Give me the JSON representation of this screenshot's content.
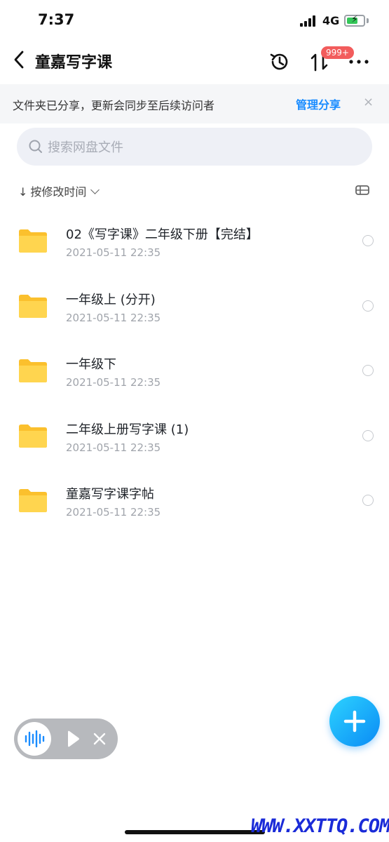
{
  "status_bar": {
    "time": "7:37",
    "network": "4G"
  },
  "nav": {
    "title": "童嘉写字课",
    "badge": "999+"
  },
  "banner": {
    "text": "文件夹已分享，更新会同步至后续访问者",
    "link": "管理分享",
    "close": "×"
  },
  "search": {
    "placeholder": "搜索网盘文件"
  },
  "sort": {
    "label": "按修改时间",
    "arrow": "↓"
  },
  "files": [
    {
      "name": "02《写字课》二年级下册【完结】",
      "date": "2021-05-11 22:35"
    },
    {
      "name": "一年级上 (分开)",
      "date": "2021-05-11 22:35"
    },
    {
      "name": "一年级下",
      "date": "2021-05-11 22:35"
    },
    {
      "name": "二年级上册写字课 (1)",
      "date": "2021-05-11 22:35"
    },
    {
      "name": "童嘉写字课字帖",
      "date": "2021-05-11 22:35"
    }
  ],
  "watermark": "WWW.XXTTQ.COM",
  "colors": {
    "accent": "#1a8cff",
    "folder": "#fbc02d",
    "badge": "#f25c5c"
  },
  "icons": [
    "back-icon",
    "history-icon",
    "transfer-icon",
    "more-icon",
    "search-icon",
    "folder-icon",
    "plus-icon",
    "voice-wave-icon",
    "play-icon",
    "close-icon"
  ]
}
